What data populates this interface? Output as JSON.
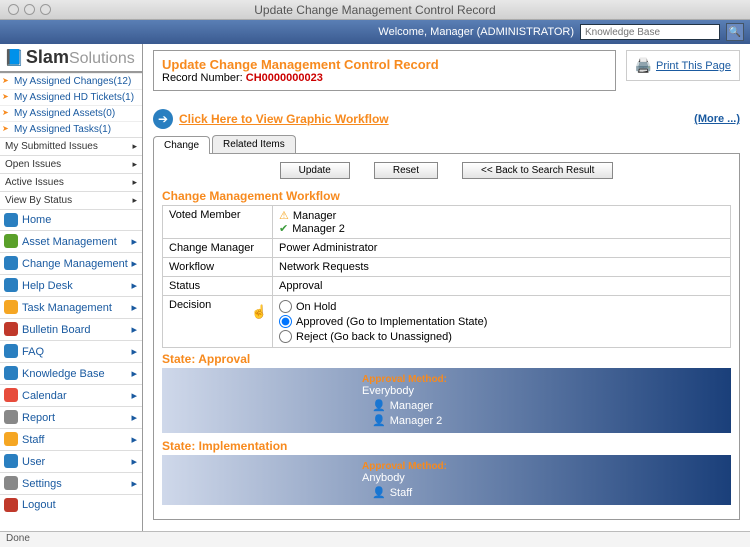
{
  "mac": {
    "title": "Update Change Management Control Record"
  },
  "topbar": {
    "welcome": "Welcome, Manager (ADMINISTRATOR)",
    "search_placeholder": "Knowledge Base"
  },
  "logo": {
    "brand": "Slam",
    "sub": "Solutions"
  },
  "nav_assigned": [
    "My Assigned Changes(12)",
    "My Assigned HD Tickets(1)",
    "My Assigned Assets(0)",
    "My Assigned Tasks(1)"
  ],
  "nav_menus": [
    "My Submitted Issues",
    "Open Issues",
    "Active Issues",
    "View By Status"
  ],
  "nav_main": [
    {
      "label": "Home",
      "arrow": false,
      "color": "#2a7fc0"
    },
    {
      "label": "Asset Management",
      "arrow": true,
      "color": "#5aa02a"
    },
    {
      "label": "Change Management",
      "arrow": true,
      "color": "#2a7fc0"
    },
    {
      "label": "Help Desk",
      "arrow": true,
      "color": "#2a7fc0"
    },
    {
      "label": "Task Management",
      "arrow": true,
      "color": "#f5a623"
    },
    {
      "label": "Bulletin Board",
      "arrow": true,
      "color": "#c0392b"
    },
    {
      "label": "FAQ",
      "arrow": true,
      "color": "#2a7fc0"
    },
    {
      "label": "Knowledge Base",
      "arrow": true,
      "color": "#2a7fc0"
    },
    {
      "label": "Calendar",
      "arrow": true,
      "color": "#e74c3c"
    },
    {
      "label": "Report",
      "arrow": true,
      "color": "#888"
    },
    {
      "label": "Staff",
      "arrow": true,
      "color": "#f5a623"
    },
    {
      "label": "User",
      "arrow": true,
      "color": "#2a7fc0"
    },
    {
      "label": "Settings",
      "arrow": true,
      "color": "#888"
    },
    {
      "label": "Logout",
      "arrow": false,
      "color": "#c0392b"
    }
  ],
  "header": {
    "title": "Update Change Management Control Record",
    "record_label": "Record Number:",
    "record_number": "CH0000000023",
    "print": "Print This Page"
  },
  "workflow_link": {
    "text": "Click Here to View Graphic Workflow",
    "more": "(More ...)"
  },
  "tabs": {
    "change": "Change",
    "related": "Related Items"
  },
  "buttons": {
    "update": "Update",
    "reset": "Reset",
    "back": "<< Back to Search Result"
  },
  "cm": {
    "section": "Change Management Workflow",
    "voted_label": "Voted Member",
    "voted1": "Manager",
    "voted2": "Manager 2",
    "cm_label": "Change Manager",
    "cm_val": "Power Administrator",
    "wf_label": "Workflow",
    "wf_val": "Network Requests",
    "status_label": "Status",
    "status_val": "Approval",
    "decision_label": "Decision",
    "radio1": "On Hold",
    "radio2": "Approved (Go to Implementation State)",
    "radio3": "Reject (Go back to Unassigned)"
  },
  "state1": {
    "title": "State: Approval",
    "method_label": "Approval Method:",
    "method_val": "Everybody",
    "p1": "Manager",
    "p2": "Manager 2"
  },
  "state2": {
    "title": "State: Implementation",
    "method_label": "Approval Method:",
    "method_val": "Anybody",
    "p1": "Staff"
  },
  "status": "Done"
}
